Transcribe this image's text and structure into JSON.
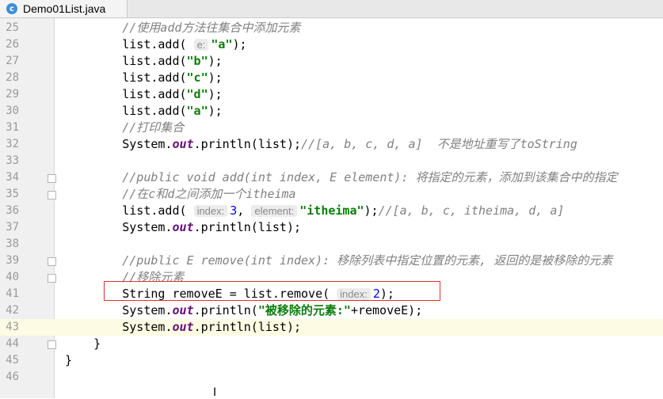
{
  "tab": {
    "icon_letter": "c",
    "title": "Demo01List.java"
  },
  "lines": [
    {
      "n": "25",
      "code": [
        {
          "t": "        "
        },
        {
          "t": "//使用add方法往集合中添加元素",
          "c": "cm"
        }
      ]
    },
    {
      "n": "26",
      "code": [
        {
          "t": "        list.add( "
        },
        {
          "t": "e:",
          "c": "hint"
        },
        {
          "t": "\"a\"",
          "c": "st"
        },
        {
          "t": ");"
        }
      ]
    },
    {
      "n": "27",
      "code": [
        {
          "t": "        list.add("
        },
        {
          "t": "\"b\"",
          "c": "st"
        },
        {
          "t": ");"
        }
      ]
    },
    {
      "n": "28",
      "code": [
        {
          "t": "        list.add("
        },
        {
          "t": "\"c\"",
          "c": "st"
        },
        {
          "t": ");"
        }
      ]
    },
    {
      "n": "29",
      "code": [
        {
          "t": "        list.add("
        },
        {
          "t": "\"d\"",
          "c": "st"
        },
        {
          "t": ");"
        }
      ]
    },
    {
      "n": "30",
      "code": [
        {
          "t": "        list.add("
        },
        {
          "t": "\"a\"",
          "c": "st"
        },
        {
          "t": ");"
        }
      ]
    },
    {
      "n": "31",
      "code": [
        {
          "t": "        "
        },
        {
          "t": "//打印集合",
          "c": "cm"
        }
      ]
    },
    {
      "n": "32",
      "code": [
        {
          "t": "        System."
        },
        {
          "t": "out",
          "c": "fd"
        },
        {
          "t": ".println(list);"
        },
        {
          "t": "//[a, b, c, d, a]  不是地址重写了toString",
          "c": "cm"
        }
      ]
    },
    {
      "n": "33",
      "code": []
    },
    {
      "n": "34",
      "code": [
        {
          "t": "        "
        },
        {
          "t": "//public void add(int index, E element): 将指定的元素，添加到该集合中的指定",
          "c": "cm"
        }
      ]
    },
    {
      "n": "35",
      "code": [
        {
          "t": "        "
        },
        {
          "t": "//在c和d之间添加一个itheima",
          "c": "cm"
        }
      ]
    },
    {
      "n": "36",
      "code": [
        {
          "t": "        list.add( "
        },
        {
          "t": "index:",
          "c": "hint"
        },
        {
          "t": "3",
          "c": "num"
        },
        {
          "t": ", "
        },
        {
          "t": "element:",
          "c": "hint"
        },
        {
          "t": "\"itheima\"",
          "c": "st"
        },
        {
          "t": ");"
        },
        {
          "t": "//[a, b, c, itheima, d, a]",
          "c": "cm"
        }
      ]
    },
    {
      "n": "37",
      "code": [
        {
          "t": "        System."
        },
        {
          "t": "out",
          "c": "fd"
        },
        {
          "t": ".println(list);"
        }
      ]
    },
    {
      "n": "38",
      "code": []
    },
    {
      "n": "39",
      "code": [
        {
          "t": "        "
        },
        {
          "t": "//public E remove(int index): 移除列表中指定位置的元素, 返回的是被移除的元素",
          "c": "cm"
        }
      ]
    },
    {
      "n": "40",
      "code": [
        {
          "t": "        "
        },
        {
          "t": "//移除元素",
          "c": "cm"
        }
      ]
    },
    {
      "n": "41",
      "code": [
        {
          "t": "        String removeE = list.remove( "
        },
        {
          "t": "index:",
          "c": "hint"
        },
        {
          "t": "2",
          "c": "num"
        },
        {
          "t": ");"
        }
      ]
    },
    {
      "n": "42",
      "code": [
        {
          "t": "        System."
        },
        {
          "t": "out",
          "c": "fd"
        },
        {
          "t": ".println("
        },
        {
          "t": "\"被移除的元素:\"",
          "c": "st"
        },
        {
          "t": "+removeE);"
        }
      ]
    },
    {
      "n": "43",
      "code": [
        {
          "t": "        System."
        },
        {
          "t": "out",
          "c": "fd"
        },
        {
          "t": ".println(list);"
        }
      ],
      "current": true
    },
    {
      "n": "44",
      "code": [
        {
          "t": "    }"
        }
      ]
    },
    {
      "n": "45",
      "code": [
        {
          "t": "}"
        }
      ]
    },
    {
      "n": "46",
      "code": []
    }
  ],
  "fold_markers_at_lines": [
    "34",
    "35",
    "39",
    "40",
    "44"
  ],
  "mouse_cursor": "I",
  "colors": {
    "comment": "#808080",
    "string": "#0a7d0a",
    "field": "#660e7a",
    "number": "#0000ff",
    "box": "#e03030"
  }
}
